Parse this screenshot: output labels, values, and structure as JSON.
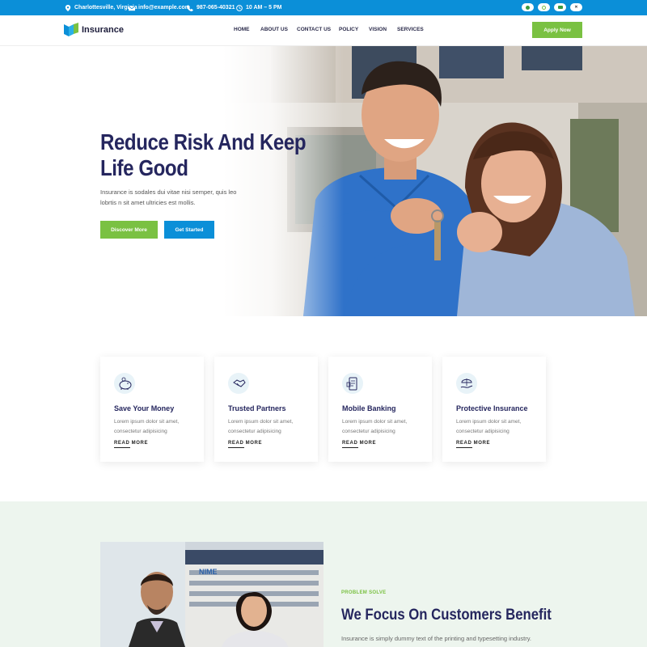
{
  "topbar": {
    "location": "Charlottesville, Virginia",
    "email": "info@example.com",
    "phone": "987-065-40321",
    "hours": "10 AM – 5 PM"
  },
  "nav": {
    "logo": "Insurance",
    "items": [
      "HOME",
      "ABOUT US",
      "CONTACT US",
      "POLICY",
      "VISION",
      "SERVICES"
    ],
    "cta": "Apply Now"
  },
  "hero": {
    "title_line1": "Reduce Risk And Keep",
    "title_line2": "Life Good",
    "text_line1": "Insurance is sodales dui vitae nisi semper, quis leo",
    "text_line2": "lobrtis n sit amet ultricies est mollis.",
    "btn_primary": "Discover More",
    "btn_secondary": "Get Started"
  },
  "features": [
    {
      "title": "Save Your Money",
      "text_line1": "Lorem ipsum dolor sit amet,",
      "text_line2": "consectetur adipisicing",
      "link": "READ MORE",
      "icon": "piggy-bank-icon"
    },
    {
      "title": "Trusted Partners",
      "text_line1": "Lorem ipsum dolor sit amet,",
      "text_line2": "consectetur adipisicing",
      "link": "READ MORE",
      "icon": "handshake-icon"
    },
    {
      "title": "Mobile Banking",
      "text_line1": "Lorem ipsum dolor sit amet,",
      "text_line2": "consectetur adipisicing",
      "link": "READ MORE",
      "icon": "mobile-bank-icon"
    },
    {
      "title": "Protective Insurance",
      "text_line1": "Lorem ipsum dolor sit amet,",
      "text_line2": "consectetur adipisicing",
      "link": "READ MORE",
      "icon": "hand-umbrella-icon"
    }
  ],
  "about": {
    "tag": "PROBLEM SOLVE",
    "title": "We Focus On Customers Benefit",
    "text": "Insurance is simply dummy text of the printing and typesetting industry.",
    "sign_text": "NIME"
  },
  "colors": {
    "primary_blue": "#0b8fd8",
    "accent_green": "#7ac142",
    "heading_navy": "#25265e",
    "section_bg": "#edf5ee"
  }
}
